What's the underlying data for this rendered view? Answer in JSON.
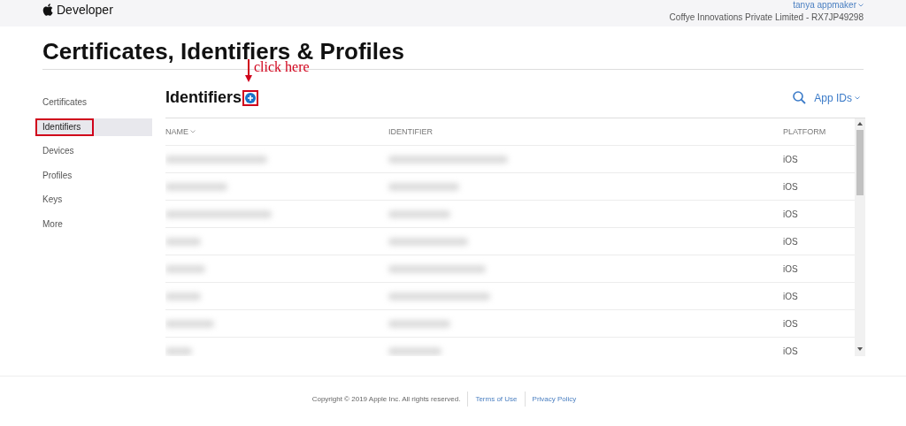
{
  "header": {
    "brand": "Developer",
    "user": "tanya appmaker",
    "team": "Coffye Innovations Private Limited - RX7JP49298"
  },
  "page_title": "Certificates, Identifiers & Profiles",
  "sidebar": {
    "items": [
      {
        "label": "Certificates",
        "selected": false,
        "highlighted": false
      },
      {
        "label": "Identifiers",
        "selected": true,
        "highlighted": true
      },
      {
        "label": "Devices",
        "selected": false,
        "highlighted": false
      },
      {
        "label": "Profiles",
        "selected": false,
        "highlighted": false
      },
      {
        "label": "Keys",
        "selected": false,
        "highlighted": false
      },
      {
        "label": "More",
        "selected": false,
        "highlighted": false
      }
    ]
  },
  "section": {
    "title": "Identifiers",
    "add_highlighted": true,
    "annotation": "click here",
    "filter": "App IDs"
  },
  "table": {
    "columns": [
      "NAME",
      "IDENTIFIER",
      "PLATFORM"
    ],
    "rows": [
      {
        "platform": "iOS"
      },
      {
        "platform": "iOS"
      },
      {
        "platform": "iOS"
      },
      {
        "platform": "iOS"
      },
      {
        "platform": "iOS"
      },
      {
        "platform": "iOS"
      },
      {
        "platform": "iOS"
      },
      {
        "platform": "iOS"
      }
    ]
  },
  "footer": {
    "copyright": "Copyright © 2019 Apple Inc. All rights reserved.",
    "links": [
      "Terms of Use",
      "Privacy Policy"
    ]
  }
}
